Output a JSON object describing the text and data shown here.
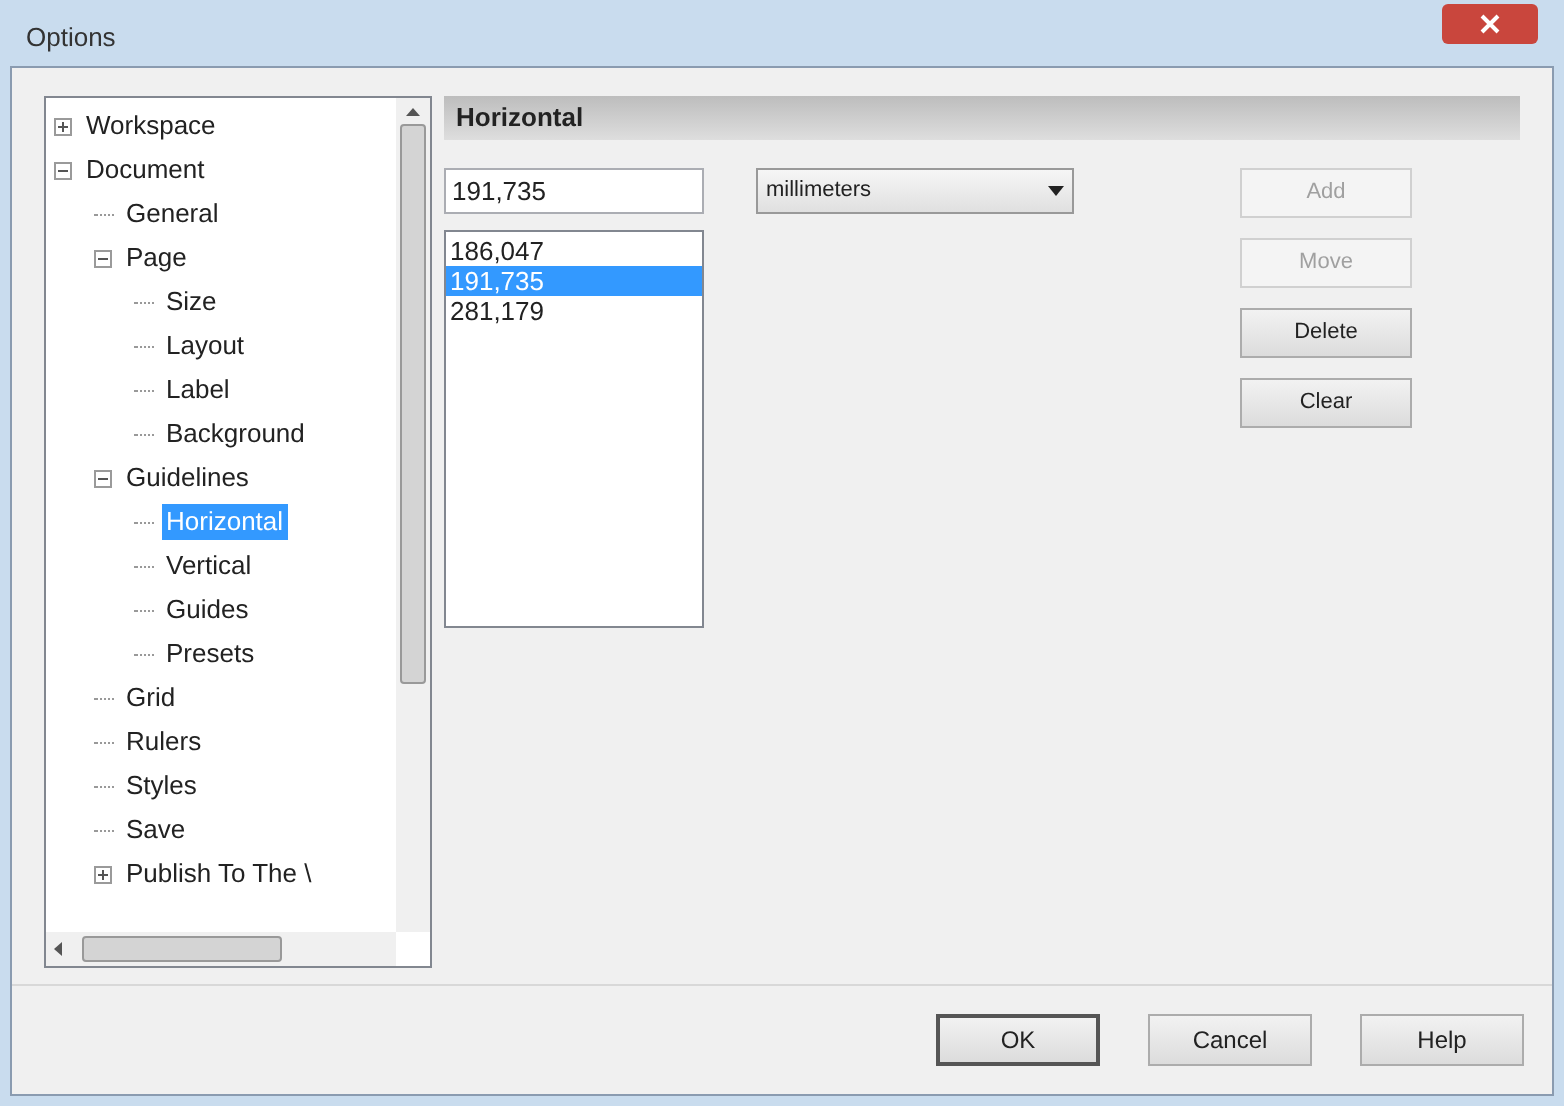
{
  "window": {
    "title": "Options"
  },
  "tree": [
    {
      "label": "Workspace",
      "expanded": false,
      "selected": false
    },
    {
      "label": "Document",
      "expanded": true,
      "selected": false,
      "children": [
        {
          "label": "General",
          "selected": false
        },
        {
          "label": "Page",
          "expanded": true,
          "selected": false,
          "children": [
            {
              "label": "Size",
              "selected": false
            },
            {
              "label": "Layout",
              "selected": false
            },
            {
              "label": "Label",
              "selected": false
            },
            {
              "label": "Background",
              "selected": false
            }
          ]
        },
        {
          "label": "Guidelines",
          "expanded": true,
          "selected": false,
          "children": [
            {
              "label": "Horizontal",
              "selected": true
            },
            {
              "label": "Vertical",
              "selected": false
            },
            {
              "label": "Guides",
              "selected": false
            },
            {
              "label": "Presets",
              "selected": false
            }
          ]
        },
        {
          "label": "Grid",
          "selected": false
        },
        {
          "label": "Rulers",
          "selected": false
        },
        {
          "label": "Styles",
          "selected": false
        },
        {
          "label": "Save",
          "selected": false
        },
        {
          "label": "Publish To The \\",
          "expanded": false,
          "selected": false
        }
      ]
    }
  ],
  "panel": {
    "title": "Horizontal",
    "value": "191,735",
    "unit": "millimeters",
    "positions": [
      {
        "label": "186,047",
        "selected": false
      },
      {
        "label": "191,735",
        "selected": true
      },
      {
        "label": "281,179",
        "selected": false
      }
    ],
    "actions": [
      {
        "label": "Add",
        "disabled": true
      },
      {
        "label": "Move",
        "disabled": true
      },
      {
        "label": "Delete",
        "disabled": false
      },
      {
        "label": "Clear",
        "disabled": false
      }
    ]
  },
  "buttons": [
    {
      "label": "OK",
      "default": true
    },
    {
      "label": "Cancel",
      "default": false
    },
    {
      "label": "Help",
      "default": false
    }
  ]
}
